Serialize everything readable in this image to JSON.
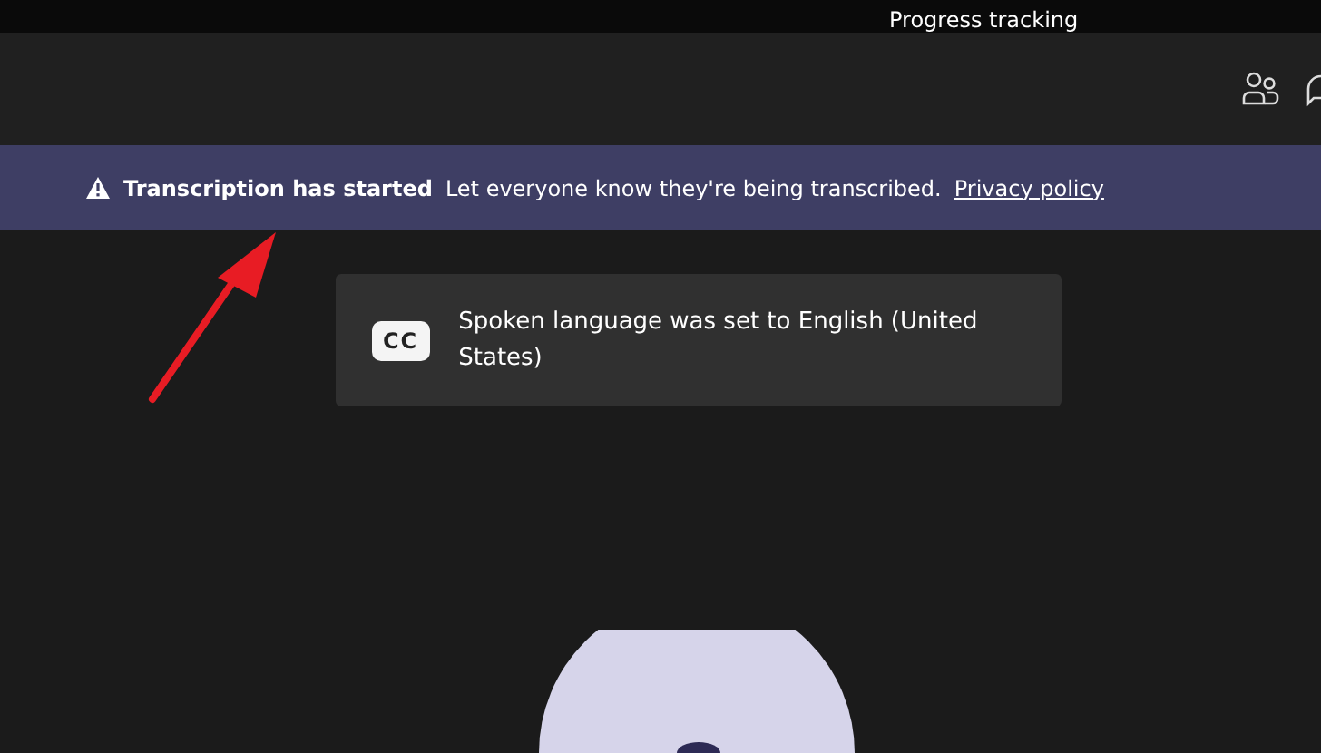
{
  "top_bar": {
    "title": "Progress tracking"
  },
  "banner": {
    "title": "Transcription has started",
    "message": "Let everyone know they're being transcribed.",
    "link": "Privacy policy"
  },
  "toast": {
    "badge": "CC",
    "message": "Spoken language was set to English (United States)"
  }
}
